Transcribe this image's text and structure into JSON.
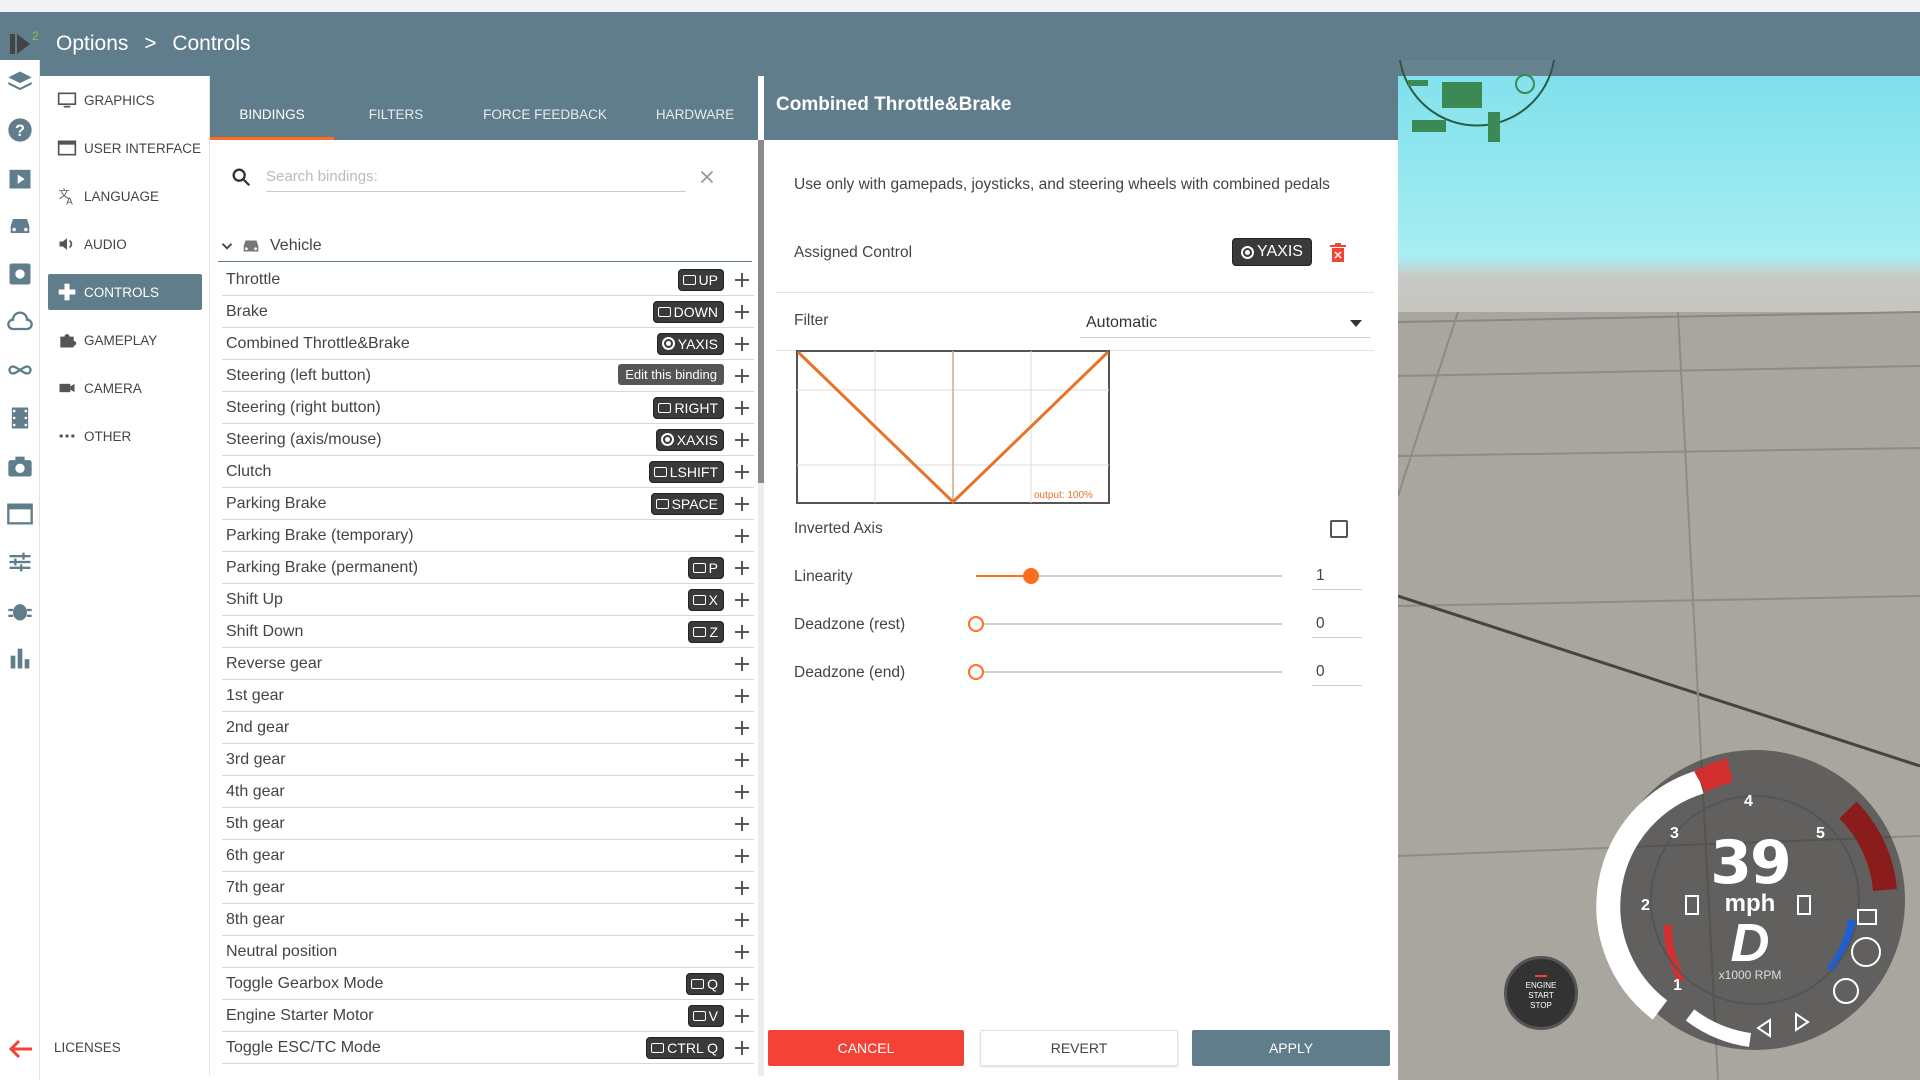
{
  "breadcrumb": {
    "parent": "Options",
    "separator": ">",
    "current": "Controls"
  },
  "categories": [
    {
      "label": "GRAPHICS",
      "icon": "monitor-icon"
    },
    {
      "label": "USER INTERFACE",
      "icon": "window-icon"
    },
    {
      "label": "LANGUAGE",
      "icon": "translate-icon"
    },
    {
      "label": "AUDIO",
      "icon": "speaker-icon"
    },
    {
      "label": "CONTROLS",
      "icon": "gamepad-icon",
      "active": true
    },
    {
      "label": "GAMEPLAY",
      "icon": "puzzle-icon"
    },
    {
      "label": "CAMERA",
      "icon": "video-camera-icon"
    },
    {
      "label": "OTHER",
      "icon": "more-dots-icon"
    }
  ],
  "licenses_label": "LICENSES",
  "tabs": [
    "BINDINGS",
    "FILTERS",
    "FORCE FEEDBACK",
    "HARDWARE"
  ],
  "search": {
    "placeholder": "Search bindings:"
  },
  "group": {
    "label": "Vehicle"
  },
  "bindings": [
    {
      "label": "Throttle",
      "key": "UP",
      "type": "key"
    },
    {
      "label": "Brake",
      "key": "DOWN",
      "type": "key"
    },
    {
      "label": "Combined Throttle&Brake",
      "key": "YAXIS",
      "type": "axis"
    },
    {
      "label": "Steering (left button)",
      "key": "",
      "type": "tooltip"
    },
    {
      "label": "Steering (right button)",
      "key": "RIGHT",
      "type": "key"
    },
    {
      "label": "Steering (axis/mouse)",
      "key": "XAXIS",
      "type": "axis"
    },
    {
      "label": "Clutch",
      "key": "LSHIFT",
      "type": "key"
    },
    {
      "label": "Parking Brake",
      "key": "SPACE",
      "type": "key"
    },
    {
      "label": "Parking Brake (temporary)",
      "key": "",
      "type": "none"
    },
    {
      "label": "Parking Brake (permanent)",
      "key": "P",
      "type": "key"
    },
    {
      "label": "Shift Up",
      "key": "X",
      "type": "key"
    },
    {
      "label": "Shift Down",
      "key": "Z",
      "type": "key"
    },
    {
      "label": "Reverse gear",
      "key": "",
      "type": "none"
    },
    {
      "label": "1st gear",
      "key": "",
      "type": "none"
    },
    {
      "label": "2nd gear",
      "key": "",
      "type": "none"
    },
    {
      "label": "3rd gear",
      "key": "",
      "type": "none"
    },
    {
      "label": "4th gear",
      "key": "",
      "type": "none"
    },
    {
      "label": "5th gear",
      "key": "",
      "type": "none"
    },
    {
      "label": "6th gear",
      "key": "",
      "type": "none"
    },
    {
      "label": "7th gear",
      "key": "",
      "type": "none"
    },
    {
      "label": "8th gear",
      "key": "",
      "type": "none"
    },
    {
      "label": "Neutral position",
      "key": "",
      "type": "none"
    },
    {
      "label": "Toggle Gearbox Mode",
      "key": "Q",
      "type": "key"
    },
    {
      "label": "Engine Starter Motor",
      "key": "V",
      "type": "key"
    },
    {
      "label": "Toggle ESC/TC Mode",
      "key": "CTRL Q",
      "type": "key"
    }
  ],
  "tooltip_text": "Edit this binding",
  "detail": {
    "title": "Combined Throttle&Brake",
    "hint": "Use only with gamepads, joysticks, and steering wheels with combined pedals",
    "assigned_label": "Assigned Control",
    "assigned_value": "YAXIS",
    "filter_label": "Filter",
    "filter_value": "Automatic",
    "curve_output": "output: 100%",
    "inverted_label": "Inverted Axis",
    "inverted_checked": false,
    "linearity_label": "Linearity",
    "linearity_value": "1",
    "linearity_fraction": 0.18,
    "deadzone_rest_label": "Deadzone (rest)",
    "deadzone_rest_value": "0",
    "deadzone_end_label": "Deadzone (end)",
    "deadzone_end_value": "0"
  },
  "buttons": {
    "cancel": "CANCEL",
    "revert": "REVERT",
    "apply": "APPLY"
  },
  "hud": {
    "speed": "39",
    "unit": "mph",
    "gear": "D",
    "rpm_label": "x1000 RPM",
    "gauge_ticks": [
      "1",
      "2",
      "3",
      "4",
      "5"
    ],
    "engine_button": [
      "ENGINE",
      "START",
      "STOP"
    ]
  },
  "colors": {
    "accent": "#ff6d1f",
    "header": "#607d8b",
    "cancel": "#f44336"
  }
}
